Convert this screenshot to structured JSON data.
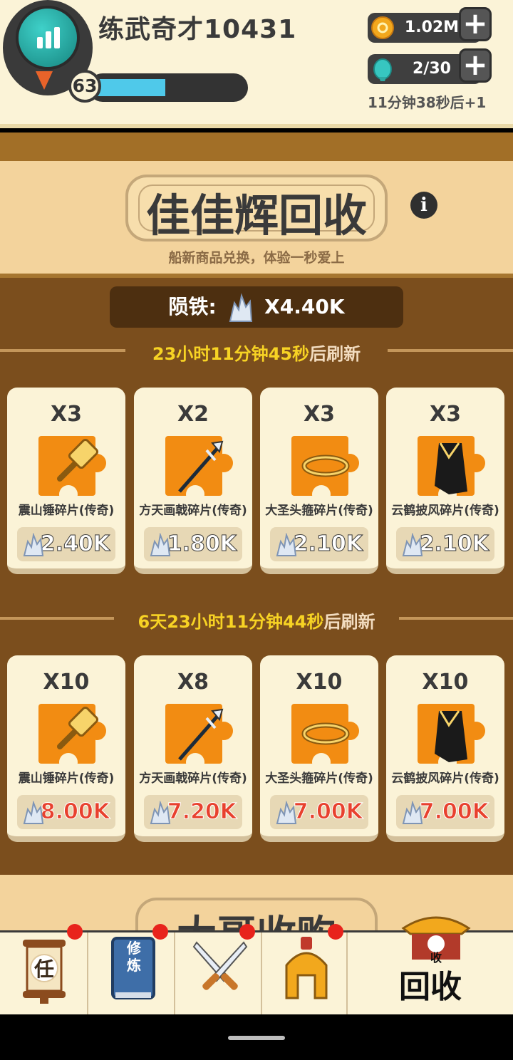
{
  "player": {
    "name": "练武奇才10431",
    "level": "63",
    "xp_fraction": 0.48
  },
  "resources": {
    "coins": "1.02M",
    "stamina": "2/30",
    "regen": "11分钟38秒后+1"
  },
  "shop": {
    "title": "佳佳辉回收",
    "subtitle": "船新商品兑换，体验一秒爱上",
    "info_label": "i",
    "currency_label": "陨铁:",
    "currency_amount": "X4.40K"
  },
  "sections": [
    {
      "timer_number": "23小时11分钟45秒",
      "timer_suffix": "后刷新",
      "items": [
        {
          "qty": "X3",
          "name": "震山锤碎片(传奇)",
          "price": "2.40K",
          "icon": "hammer-icon"
        },
        {
          "qty": "X2",
          "name": "方天画戟碎片(传奇)",
          "price": "1.80K",
          "icon": "halberd-icon"
        },
        {
          "qty": "X3",
          "name": "大圣头箍碎片(传奇)",
          "price": "2.10K",
          "icon": "headband-icon"
        },
        {
          "qty": "X3",
          "name": "云鹤披风碎片(传奇)",
          "price": "2.10K",
          "icon": "cape-icon"
        }
      ]
    },
    {
      "timer_number": "6天23小时11分钟44秒",
      "timer_suffix": "后刷新",
      "items": [
        {
          "qty": "X10",
          "name": "震山锤碎片(传奇)",
          "price": "8.00K",
          "icon": "hammer-icon"
        },
        {
          "qty": "X8",
          "name": "方天画戟碎片(传奇)",
          "price": "7.20K",
          "icon": "halberd-icon"
        },
        {
          "qty": "X10",
          "name": "大圣头箍碎片(传奇)",
          "price": "7.00K",
          "icon": "headband-icon"
        },
        {
          "qty": "X10",
          "name": "云鹤披风碎片(传奇)",
          "price": "7.00K",
          "icon": "cape-icon"
        }
      ]
    }
  ],
  "next_banner": "大哥收购",
  "nav": {
    "task_icon_text": "任",
    "cultivate_icon_text": "修炼",
    "recycle_icon_text": "收",
    "recycle_label": "回收"
  },
  "colors": {
    "timer_yellow": "#f7d324",
    "price_red": "#e8412e",
    "panel_brown": "#7b4e1d"
  }
}
